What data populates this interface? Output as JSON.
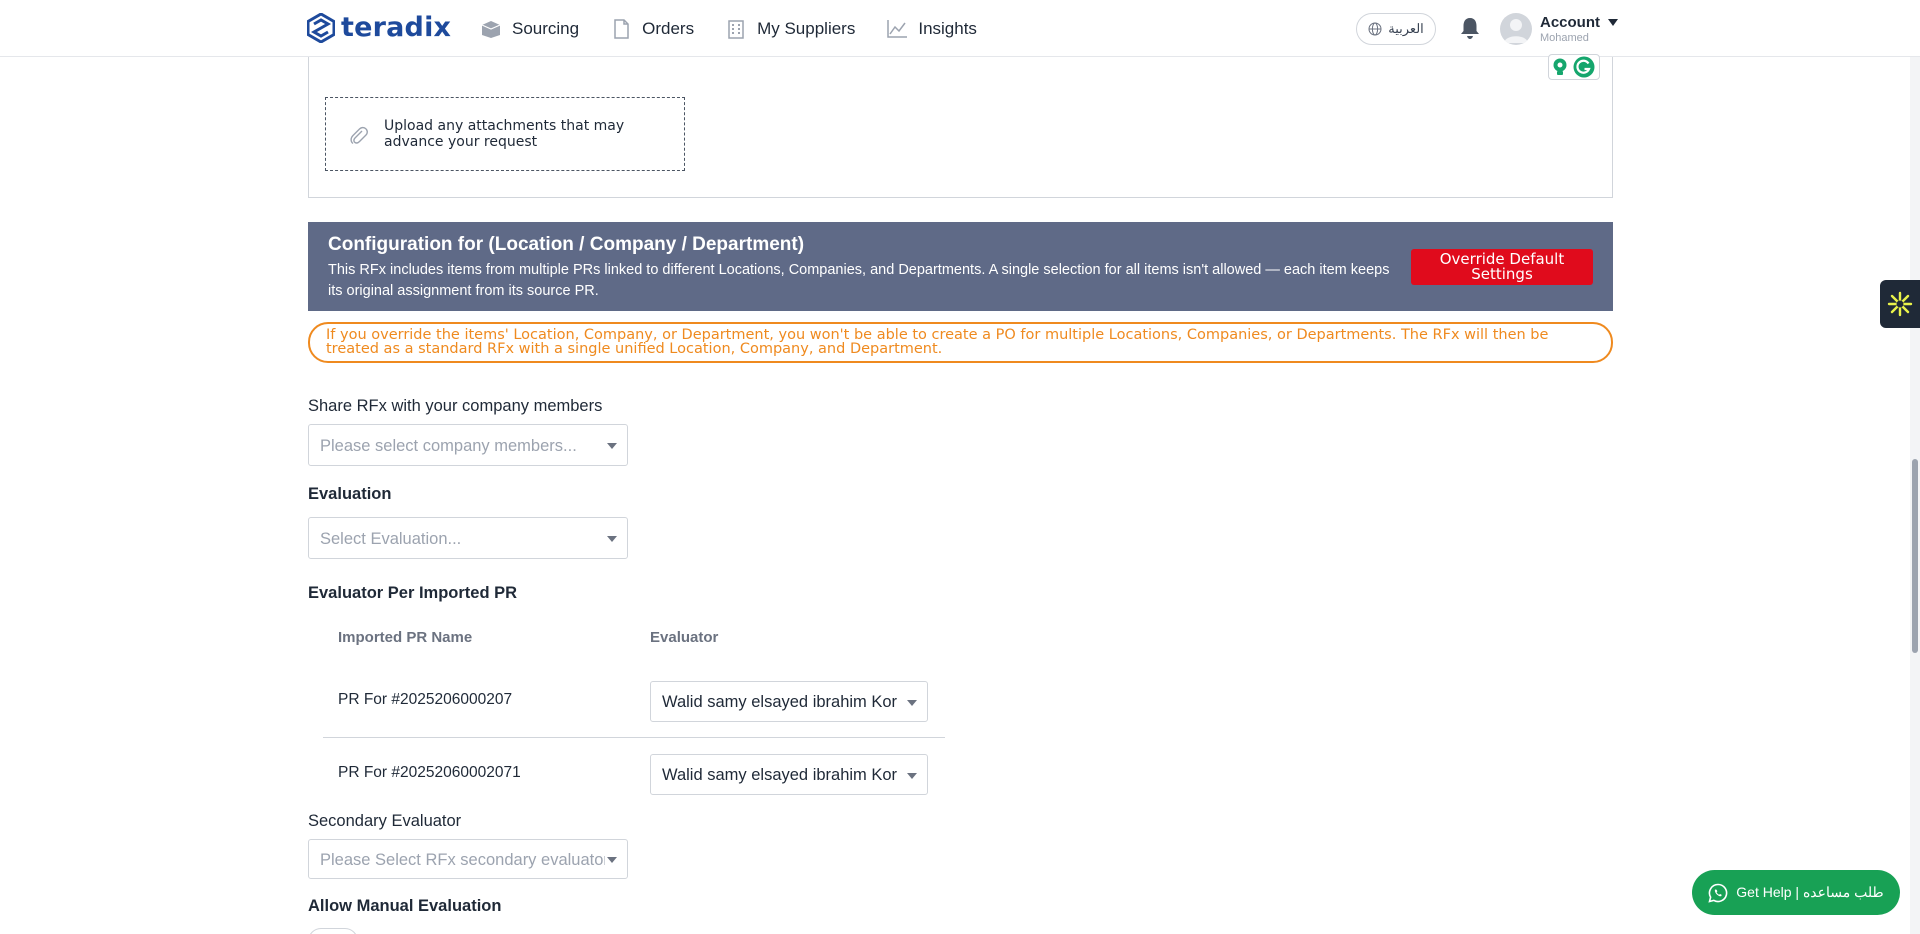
{
  "nav": {
    "logo_text": "teradix",
    "items": [
      {
        "label": "Sourcing",
        "icon": "box-icon"
      },
      {
        "label": "Orders",
        "icon": "document-icon"
      },
      {
        "label": "My Suppliers",
        "icon": "building-icon"
      },
      {
        "label": "Insights",
        "icon": "chart-line-icon"
      }
    ],
    "language_label": "العربية",
    "account_label": "Account",
    "account_user": "Mohamed"
  },
  "upload": {
    "text": "Upload any attachments that may advance your request"
  },
  "config": {
    "title": "Configuration for (Location / Company / Department)",
    "description": "This RFx includes items from multiple PRs linked to different Locations, Companies, and Departments. A single selection for all items isn't allowed — each item keeps its original assignment from its source PR.",
    "override_label": "Override Default Settings"
  },
  "warning": {
    "text": "If you override the items' Location, Company, or Department, you won't be able to create a PO for multiple Locations, Companies, or Departments. The RFx will then be treated as a standard RFx with a single unified Location, Company, and Department."
  },
  "share": {
    "label": "Share RFx with your company members",
    "placeholder": "Please select company members..."
  },
  "evaluation": {
    "label": "Evaluation",
    "placeholder": "Select Evaluation..."
  },
  "evaluator_per_pr": {
    "label": "Evaluator Per Imported PR",
    "headers": [
      "Imported PR Name",
      "Evaluator"
    ],
    "rows": [
      {
        "pr_name": "PR For #2025206000207",
        "evaluator": "Walid samy elsayed ibrahim Kor"
      },
      {
        "pr_name": "PR For #20252060002071",
        "evaluator": "Walid samy elsayed ibrahim Kor"
      }
    ]
  },
  "secondary_evaluator": {
    "label": "Secondary Evaluator",
    "placeholder": "Please Select RFx secondary evaluator"
  },
  "manual_evaluation": {
    "label": "Allow Manual Evaluation"
  },
  "help": {
    "label": "Get Help | طلب مساعده"
  },
  "colors": {
    "brand": "#1e4a9c",
    "banner": "#5f6a87",
    "override": "#e00b1c",
    "warning": "#ef8a1f",
    "help": "#18a155"
  }
}
